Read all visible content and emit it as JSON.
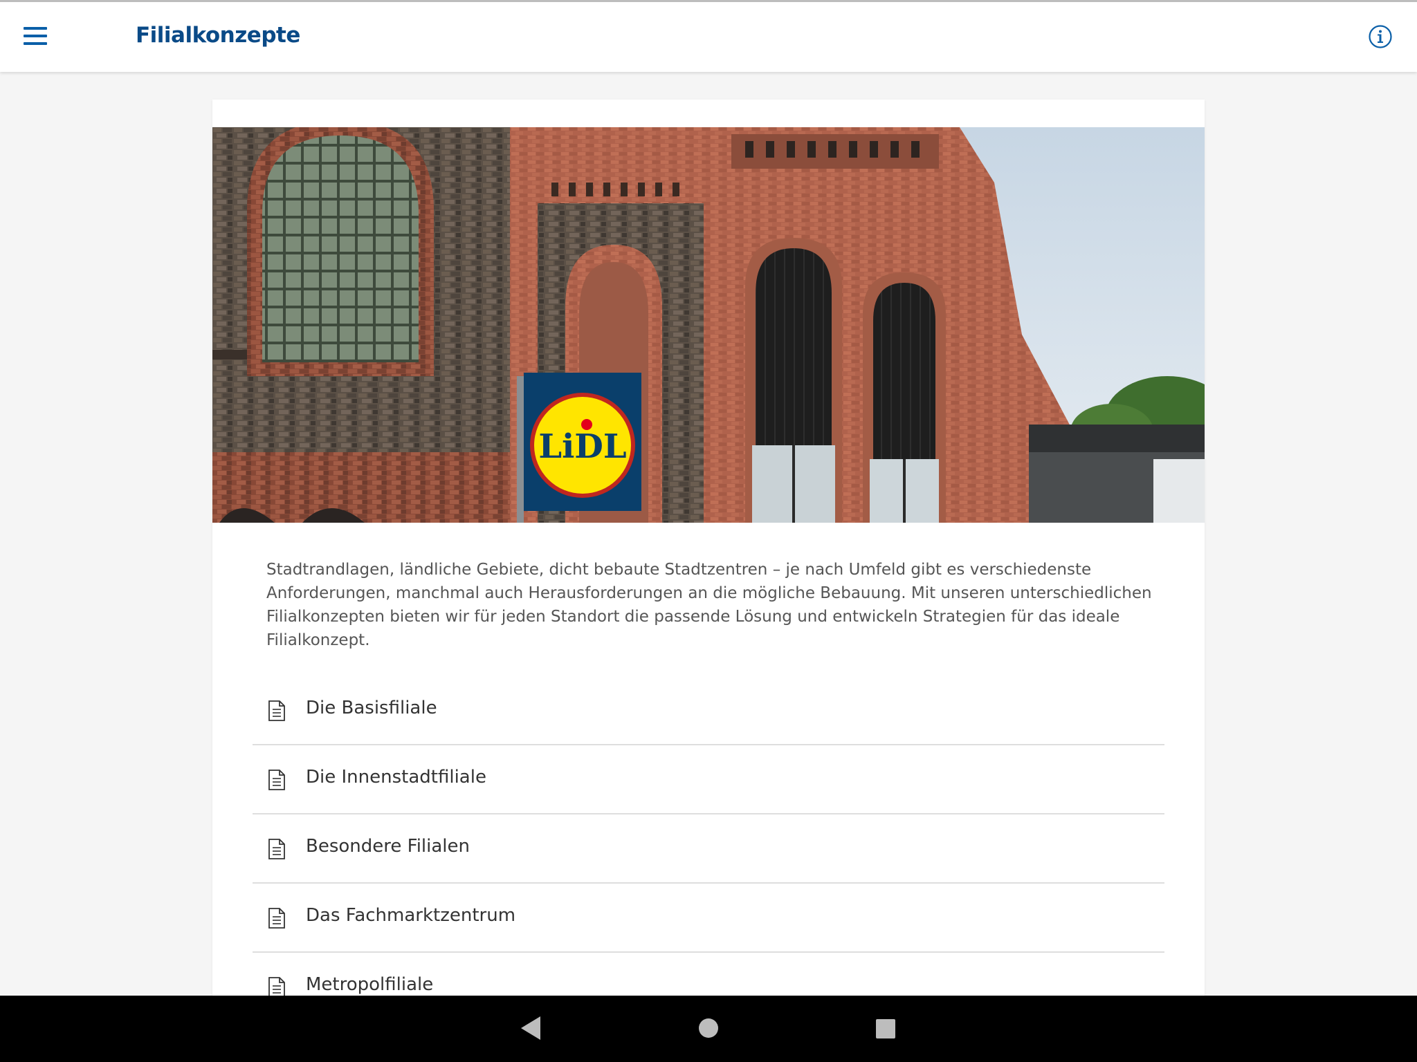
{
  "header": {
    "title": "Filialkonzepte",
    "menu_icon": "hamburger-menu-icon",
    "info_icon": "info-circle-icon"
  },
  "hero": {
    "sign_text": "LiDL"
  },
  "intro": "Stadtrandlagen, ländliche Gebiete, dicht bebaute Stadtzentren – je nach Umfeld gibt es verschiedenste Anforderungen, manchmal auch Herausforderungen an die mögliche Bebauung. Mit unseren unterschiedlichen Filialkonzepten bieten wir für jeden Standort die passende Lösung und entwickeln Strategien für das ideale Filialkonzept.",
  "items": [
    {
      "label": "Die Basisfiliale"
    },
    {
      "label": "Die Innenstadtfiliale"
    },
    {
      "label": "Besondere Filialen"
    },
    {
      "label": "Das Fachmarktzentrum"
    },
    {
      "label": "Metropolfiliale"
    }
  ],
  "colors": {
    "accent": "#0a5fa8",
    "title": "#0a4a87",
    "background": "#f5f5f5",
    "lidl_yellow": "#ffe500",
    "lidl_blue": "#0a4a87"
  },
  "system_nav": {
    "back_icon": "back-triangle-icon",
    "home_icon": "home-circle-icon",
    "recents_icon": "recents-square-icon"
  }
}
